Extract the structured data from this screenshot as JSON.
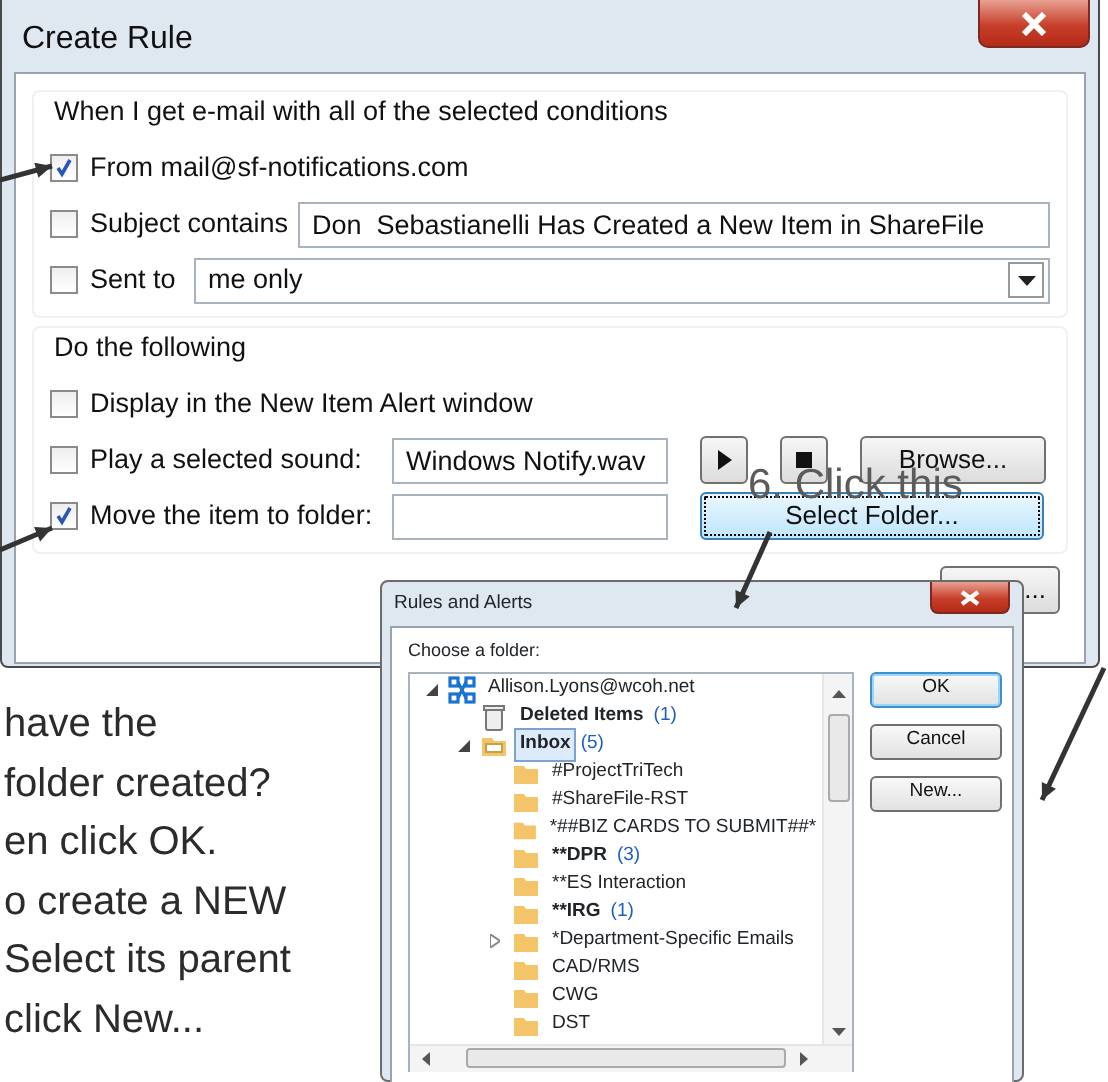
{
  "create_rule": {
    "title": "Create Rule",
    "conditions": {
      "heading": "When I get e-mail with all of the selected conditions",
      "rows": [
        {
          "kind": "check",
          "label": "From mail@sf-notifications.com",
          "checked": true
        },
        {
          "kind": "text",
          "label": "Subject contains",
          "checked": false,
          "value": "Don  Sebastianelli Has Created a New Item in ShareFile"
        },
        {
          "kind": "select",
          "label": "Sent to",
          "checked": false,
          "value": "me only"
        }
      ]
    },
    "actions": {
      "heading": "Do the following",
      "rows": [
        {
          "kind": "check",
          "label": "Display in the New Item Alert window",
          "checked": false
        },
        {
          "kind": "sound",
          "label": "Play a selected sound:",
          "checked": false,
          "value": "Windows Notify.wav",
          "button": "Browse..."
        },
        {
          "kind": "folder",
          "label": "Move the item to folder:",
          "checked": true,
          "button": "Select Folder..."
        }
      ]
    },
    "footer_button": "..."
  },
  "annotation": "6. Click this",
  "instructions": [
    {
      "text": "have the"
    },
    {
      "text": "folder created?"
    },
    {
      "text": "en click OK."
    },
    {
      "text": "o create a NEW"
    },
    {
      "text": "Select its parent"
    },
    {
      "text": "click New..."
    }
  ],
  "rules_dialog": {
    "title": "Rules and Alerts",
    "prompt": "Choose a folder:",
    "tree": [
      {
        "label": "Allison.Lyons@wcoh.net",
        "kind": "account",
        "expanded": true,
        "bold": false,
        "selected": false,
        "children": [
          {
            "label": "Deleted Items",
            "count": "(1)",
            "kind": "trash",
            "bold": true,
            "selected": false
          },
          {
            "label": "Inbox",
            "count": "(5)",
            "kind": "inbox",
            "expanded": true,
            "bold": true,
            "selected": true,
            "children": [
              {
                "label": "#ProjectTriTech",
                "kind": "folder",
                "bold": false,
                "selected": false
              },
              {
                "label": "#ShareFile-RST",
                "kind": "folder",
                "bold": false,
                "selected": false
              },
              {
                "label": "*##BIZ CARDS TO SUBMIT##*",
                "kind": "folder",
                "bold": false,
                "selected": false
              },
              {
                "label": "**DPR",
                "count": "(3)",
                "kind": "folder",
                "bold": true,
                "selected": false
              },
              {
                "label": "**ES Interaction",
                "kind": "folder",
                "bold": false,
                "selected": false
              },
              {
                "label": "**IRG",
                "count": "(1)",
                "kind": "folder",
                "bold": true,
                "selected": false
              },
              {
                "label": "*Department-Specific Emails",
                "kind": "folder",
                "expanded": false,
                "bold": false,
                "selected": false
              },
              {
                "label": "CAD/RMS",
                "kind": "folder",
                "bold": false,
                "selected": false
              },
              {
                "label": "CWG",
                "kind": "folder",
                "bold": false,
                "selected": false
              },
              {
                "label": "DST",
                "kind": "folder",
                "bold": false,
                "selected": false
              }
            ]
          }
        ]
      }
    ],
    "buttons": [
      {
        "label": "OK",
        "default": true
      },
      {
        "label": "Cancel",
        "default": false
      },
      {
        "label": "New...",
        "default": false
      }
    ]
  }
}
